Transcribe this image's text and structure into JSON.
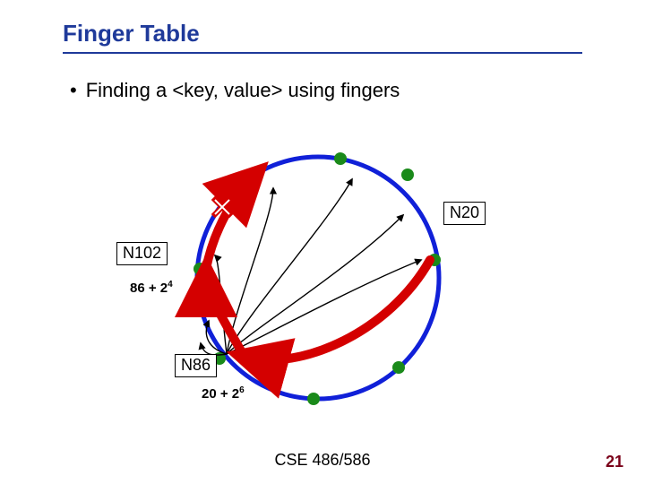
{
  "title": "Finger Table",
  "bullet": "Finding a <key, value> using fingers",
  "labels": {
    "n20": "N20",
    "n102": "N102",
    "n86": "N86"
  },
  "calcs": {
    "c1": {
      "base": "86 + 2",
      "exp": "4"
    },
    "c2": {
      "base": "20 + 2",
      "exp": "6"
    }
  },
  "footer": "CSE 486/586",
  "page": "21",
  "chart_data": {
    "type": "diagram",
    "description": "Chord ring finger-table lookup illustration",
    "ring_nodes_deg": [
      12,
      60,
      105,
      150,
      198,
      252,
      300,
      345
    ],
    "labeled_nodes": [
      {
        "name": "N20",
        "deg": 60
      },
      {
        "name": "N86",
        "deg": 198
      },
      {
        "name": "N102",
        "deg": 252
      }
    ],
    "target_marker": {
      "type": "red-x",
      "approx_deg": 300
    },
    "lookup_hops": [
      {
        "from": "N20",
        "to": "N86",
        "annotation": "20 + 2^6"
      },
      {
        "from": "N86",
        "to": "N102",
        "annotation": "86 + 2^4"
      },
      {
        "from": "N102",
        "toward_deg": 340
      }
    ],
    "finger_arcs_from": "N86",
    "finger_arcs_count": 6
  }
}
